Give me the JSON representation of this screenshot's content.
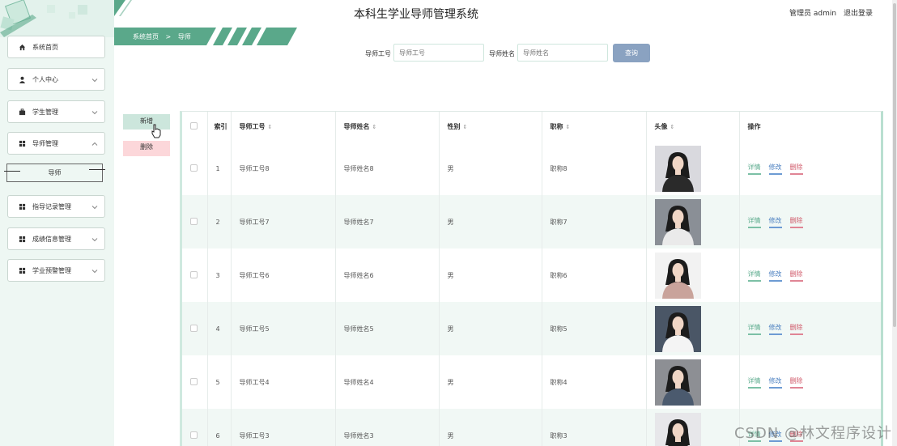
{
  "app": {
    "title": "本科生学业导师管理系统"
  },
  "user": {
    "name": "管理员 admin",
    "logout": "退出登录"
  },
  "breadcrumb": {
    "home": "系统首页",
    "sep": ">",
    "current": "导师"
  },
  "sidebar": {
    "items": [
      {
        "label": "系统首页",
        "icon": "home-icon"
      },
      {
        "label": "个人中心",
        "icon": "person-icon"
      },
      {
        "label": "学生管理",
        "icon": "briefcase-icon"
      },
      {
        "label": "导师管理",
        "icon": "grid-icon"
      },
      {
        "label": "指导记录管理",
        "icon": "grid-icon"
      },
      {
        "label": "成绩信息管理",
        "icon": "grid-icon"
      },
      {
        "label": "学业预警管理",
        "icon": "grid-icon"
      }
    ],
    "sub_item": "导师"
  },
  "search": {
    "field1_label": "导师工号",
    "field1_placeholder": "导师工号",
    "field2_label": "导师姓名",
    "field2_placeholder": "导师姓名",
    "button": "查询"
  },
  "actions": {
    "add": "新增",
    "delete": "删除"
  },
  "table": {
    "headers": {
      "index": "索引",
      "id": "导师工号",
      "name": "导师姓名",
      "gender": "性别",
      "title": "职称",
      "avatar": "头像",
      "ops": "操作"
    },
    "ops": {
      "detail": "详情",
      "edit": "修改",
      "delete": "删除"
    },
    "rows": [
      {
        "index": "1",
        "id": "导师工号8",
        "name": "导师姓名8",
        "gender": "男",
        "title": "职称8"
      },
      {
        "index": "2",
        "id": "导师工号7",
        "name": "导师姓名7",
        "gender": "男",
        "title": "职称7"
      },
      {
        "index": "3",
        "id": "导师工号6",
        "name": "导师姓名6",
        "gender": "男",
        "title": "职称6"
      },
      {
        "index": "4",
        "id": "导师工号5",
        "name": "导师姓名5",
        "gender": "男",
        "title": "职称5"
      },
      {
        "index": "5",
        "id": "导师工号4",
        "name": "导师姓名4",
        "gender": "男",
        "title": "职称4"
      },
      {
        "index": "6",
        "id": "导师工号3",
        "name": "导师姓名3",
        "gender": "男",
        "title": "职称3"
      }
    ]
  },
  "watermark": "CSDN @林文程序设计",
  "colors": {
    "accent": "#5aa88a",
    "sidebar_bg": "#eef7f3",
    "search_button": "#8aa2c1",
    "delete_bg": "#fcd7da",
    "add_bg": "#cce6dc"
  }
}
